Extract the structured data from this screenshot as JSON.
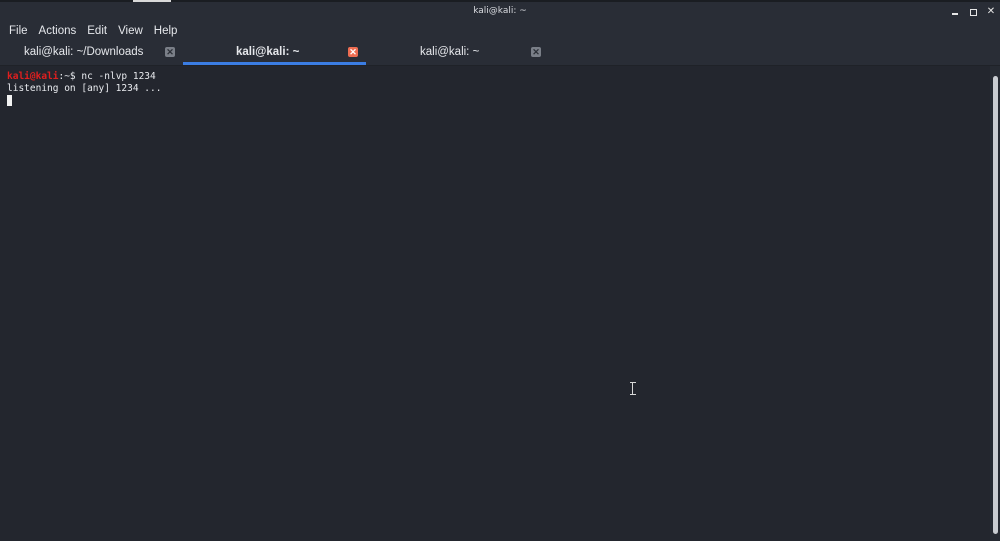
{
  "window": {
    "title": "kali@kali: ~"
  },
  "menu": {
    "items": [
      "File",
      "Actions",
      "Edit",
      "View",
      "Help"
    ]
  },
  "tabs": [
    {
      "label": "kali@kali: ~/Downloads",
      "active": false
    },
    {
      "label": "kali@kali: ~",
      "active": true
    },
    {
      "label": "kali@kali: ~",
      "active": false
    }
  ],
  "terminal": {
    "prompt_user": "kali@kali",
    "prompt_path": ":~$",
    "command": " nc -nlvp 1234",
    "output": "listening on [any] 1234 ..."
  },
  "colors": {
    "prompt_user": "#e11f1f",
    "active_tab_underline": "#3b7de3",
    "active_close": "#ee6d52",
    "background": "#23262e"
  },
  "icons": {
    "close": "close-icon",
    "minimize": "minimize-icon",
    "maximize": "maximize-icon",
    "cursor": "text-cursor-icon"
  }
}
